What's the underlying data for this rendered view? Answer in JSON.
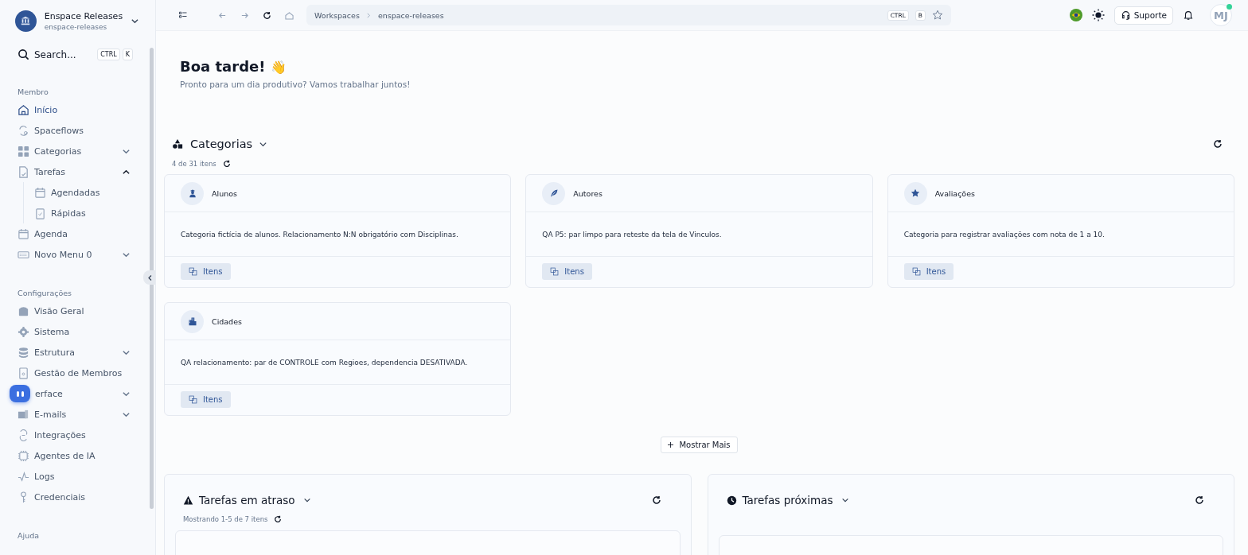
{
  "workspace": {
    "name": "Enspace Releases",
    "slug": "enspace-releases"
  },
  "search": {
    "placeholder": "Search...",
    "keys": [
      "CTRL",
      "K"
    ]
  },
  "sidebar": {
    "sections": [
      {
        "title": "Membro",
        "items": [
          {
            "label": "Início",
            "selected": true
          },
          {
            "label": "Spaceflows",
            "selected": false
          },
          {
            "label": "Categorias",
            "selected": false,
            "expanded": false
          },
          {
            "label": "Tarefas",
            "selected": false,
            "expanded": true,
            "children": [
              {
                "label": "Agendadas",
                "selected": false
              },
              {
                "label": "Rápidas",
                "selected": false
              }
            ]
          },
          {
            "label": "Agenda",
            "selected": false
          },
          {
            "label": "Novo Menu 0",
            "selected": false,
            "expanded": false
          }
        ]
      },
      {
        "title": "Configurações",
        "items": [
          {
            "label": "Visão Geral",
            "selected": false
          },
          {
            "label": "Sistema",
            "selected": false
          },
          {
            "label": "Estrutura",
            "selected": false,
            "expanded": false
          },
          {
            "label": "Gestão de Membros",
            "selected": false
          },
          {
            "label": "erface",
            "selected": false,
            "expanded": false
          },
          {
            "label": "E-mails",
            "selected": false,
            "expanded": false
          },
          {
            "label": "Integrações",
            "selected": false
          },
          {
            "label": "Agentes de IA",
            "selected": false
          },
          {
            "label": "Logs",
            "selected": false
          },
          {
            "label": "Credenciais",
            "selected": false
          }
        ]
      },
      {
        "title": "Ajuda"
      }
    ]
  },
  "breadcrumb": [
    "Workspaces",
    "enspace-releases"
  ],
  "bookmark_keys": [
    "CTRL",
    "B"
  ],
  "topbar": {
    "support": "Suporte",
    "avatar": "MJ",
    "online": true
  },
  "greeting": {
    "title": "Boa tarde!",
    "emoji": "👋",
    "subtitle": "Pronto para um dia produtivo? Vamos trabalhar juntos!"
  },
  "categories": {
    "title": "Categorias",
    "count": "4 de 31 itens",
    "more": "Mostrar Mais",
    "cards": [
      {
        "name": "Alunos",
        "description": "Categoria fictícia de alunos. Relacionamento N:N obrigatório com Disciplinas.",
        "action": "Itens"
      },
      {
        "name": "Autores",
        "description": "QA P5: par limpo para reteste da tela de Vinculos.",
        "action": "Itens"
      },
      {
        "name": "Avaliações",
        "description": "Categoria para registrar avaliações com nota de 1 a 10.",
        "action": "Itens"
      },
      {
        "name": "Cidades",
        "description": "QA relacionamento: par de CONTROLE com Regioes, dependencia DESATIVADA.",
        "action": "Itens"
      }
    ]
  },
  "panels": [
    {
      "kind": "overdue",
      "title": "Tarefas em atraso",
      "count": "Mostrando 1-5 de 7 itens"
    },
    {
      "kind": "upcoming",
      "title": "Tarefas próximas"
    }
  ]
}
